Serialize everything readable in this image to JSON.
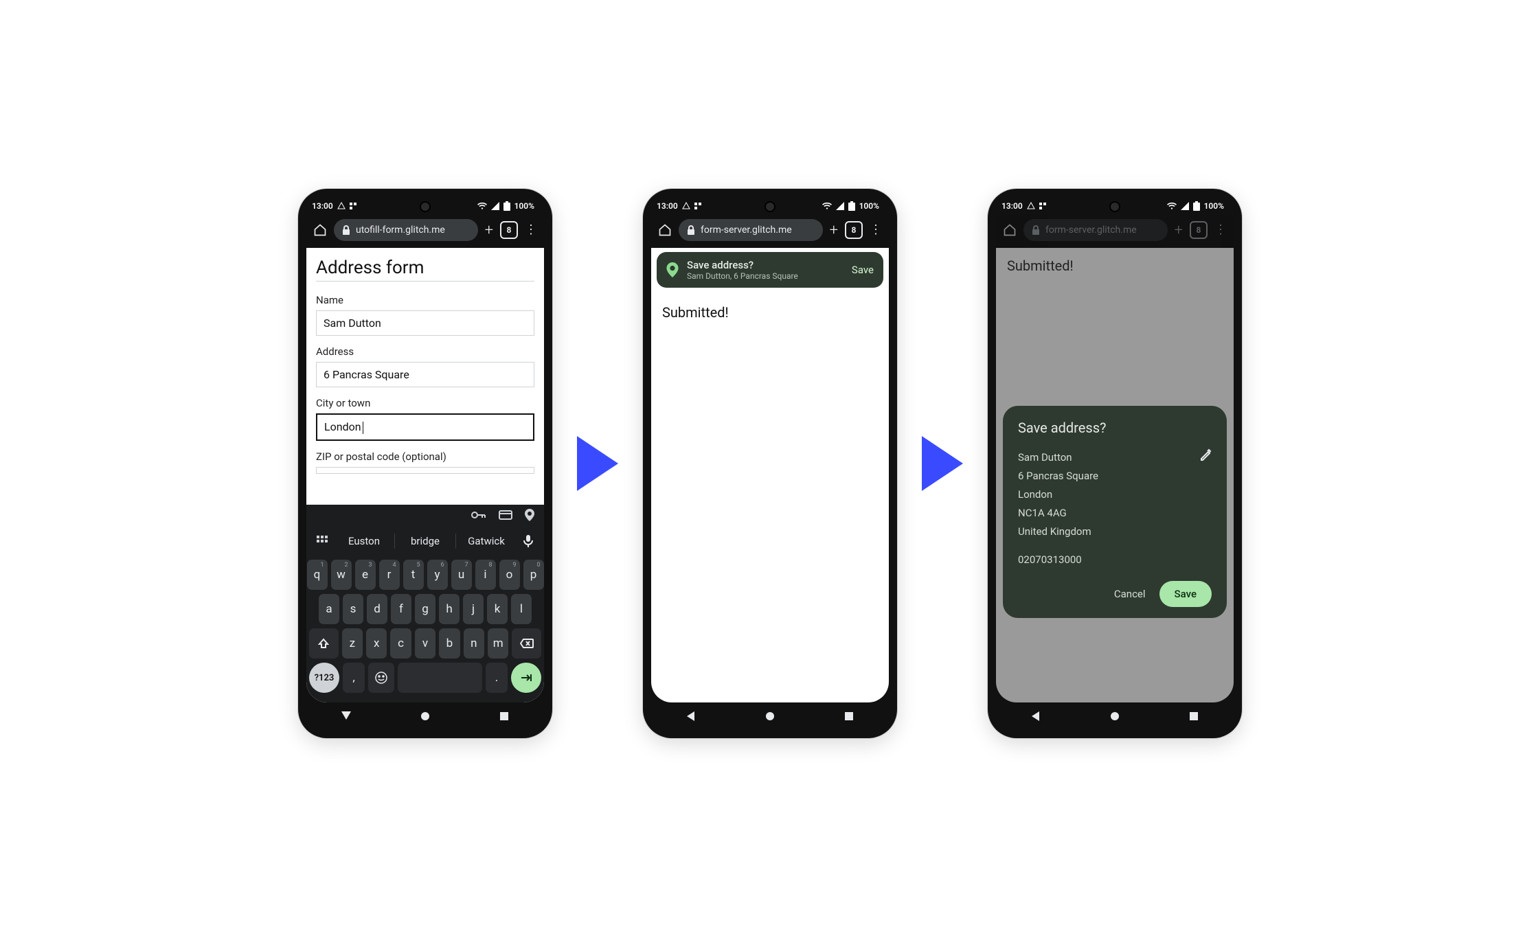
{
  "status": {
    "time": "13:00",
    "battery": "100%"
  },
  "tab_count": "8",
  "phone1": {
    "url": "utofill-form.glitch.me",
    "title": "Address form",
    "fields": {
      "name_label": "Name",
      "name_value": "Sam Dutton",
      "address_label": "Address",
      "address_value": "6 Pancras Square",
      "city_label": "City or town",
      "city_value": "London",
      "zip_label": "ZIP or postal code (optional)",
      "zip_value": ""
    },
    "suggestions": [
      "Euston",
      "bridge",
      "Gatwick"
    ],
    "keyboard": {
      "row1": [
        {
          "k": "q",
          "s": "1"
        },
        {
          "k": "w",
          "s": "2"
        },
        {
          "k": "e",
          "s": "3"
        },
        {
          "k": "r",
          "s": "4"
        },
        {
          "k": "t",
          "s": "5"
        },
        {
          "k": "y",
          "s": "6"
        },
        {
          "k": "u",
          "s": "7"
        },
        {
          "k": "i",
          "s": "8"
        },
        {
          "k": "o",
          "s": "9"
        },
        {
          "k": "p",
          "s": "0"
        }
      ],
      "row2": [
        "a",
        "s",
        "d",
        "f",
        "g",
        "h",
        "j",
        "k",
        "l"
      ],
      "row3": [
        "z",
        "x",
        "c",
        "v",
        "b",
        "n",
        "m"
      ],
      "num_key": "?123"
    }
  },
  "phone2": {
    "url": "form-server.glitch.me",
    "banner": {
      "title": "Save address?",
      "subtitle": "Sam Dutton, 6 Pancras Square",
      "action": "Save"
    },
    "body": "Submitted!"
  },
  "phone3": {
    "url": "form-server.glitch.me",
    "body": "Submitted!",
    "sheet": {
      "title": "Save address?",
      "lines": [
        "Sam Dutton",
        "6 Pancras Square",
        "London",
        "NC1A 4AG",
        "United Kingdom"
      ],
      "phone_number": "02070313000",
      "cancel": "Cancel",
      "save": "Save"
    }
  }
}
